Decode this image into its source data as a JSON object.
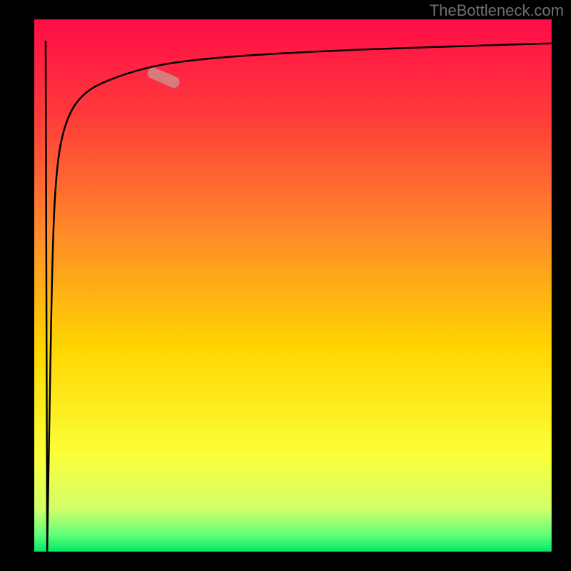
{
  "attribution": "TheBottleneck.com",
  "chart_data": {
    "type": "line",
    "title": "",
    "xlabel": "",
    "ylabel": "",
    "xlim": [
      0,
      100
    ],
    "ylim": [
      0,
      100
    ],
    "grid": false,
    "series": [
      {
        "name": "bottleneck-curve",
        "x": [
          2.5,
          3.0,
          3.5,
          4.0,
          5.0,
          7.0,
          10.0,
          14.0,
          20.0,
          26.0,
          35.0,
          50.0,
          70.0,
          100.0
        ],
        "y": [
          0.0,
          30.0,
          55.0,
          68.0,
          77.0,
          83.0,
          86.5,
          88.5,
          90.5,
          91.8,
          92.8,
          93.8,
          94.6,
          95.5
        ]
      }
    ],
    "annotations": [
      {
        "name": "highlight-segment",
        "x_range": [
          22.0,
          28.0
        ],
        "y_range": [
          87.8,
          90.3
        ]
      }
    ],
    "background_gradient": {
      "direction": "vertical",
      "stops": [
        {
          "offset": 0.0,
          "color": "#ff0d48"
        },
        {
          "offset": 0.18,
          "color": "#ff3a3a"
        },
        {
          "offset": 0.4,
          "color": "#ff8a2a"
        },
        {
          "offset": 0.62,
          "color": "#ffd600"
        },
        {
          "offset": 0.82,
          "color": "#fbff3a"
        },
        {
          "offset": 0.92,
          "color": "#d2ff6a"
        },
        {
          "offset": 0.97,
          "color": "#5cff7a"
        },
        {
          "offset": 1.0,
          "color": "#00e865"
        }
      ]
    },
    "frame": {
      "color": "#000000",
      "left_width_frac": 0.06,
      "other_width_frac": 0.034
    }
  }
}
